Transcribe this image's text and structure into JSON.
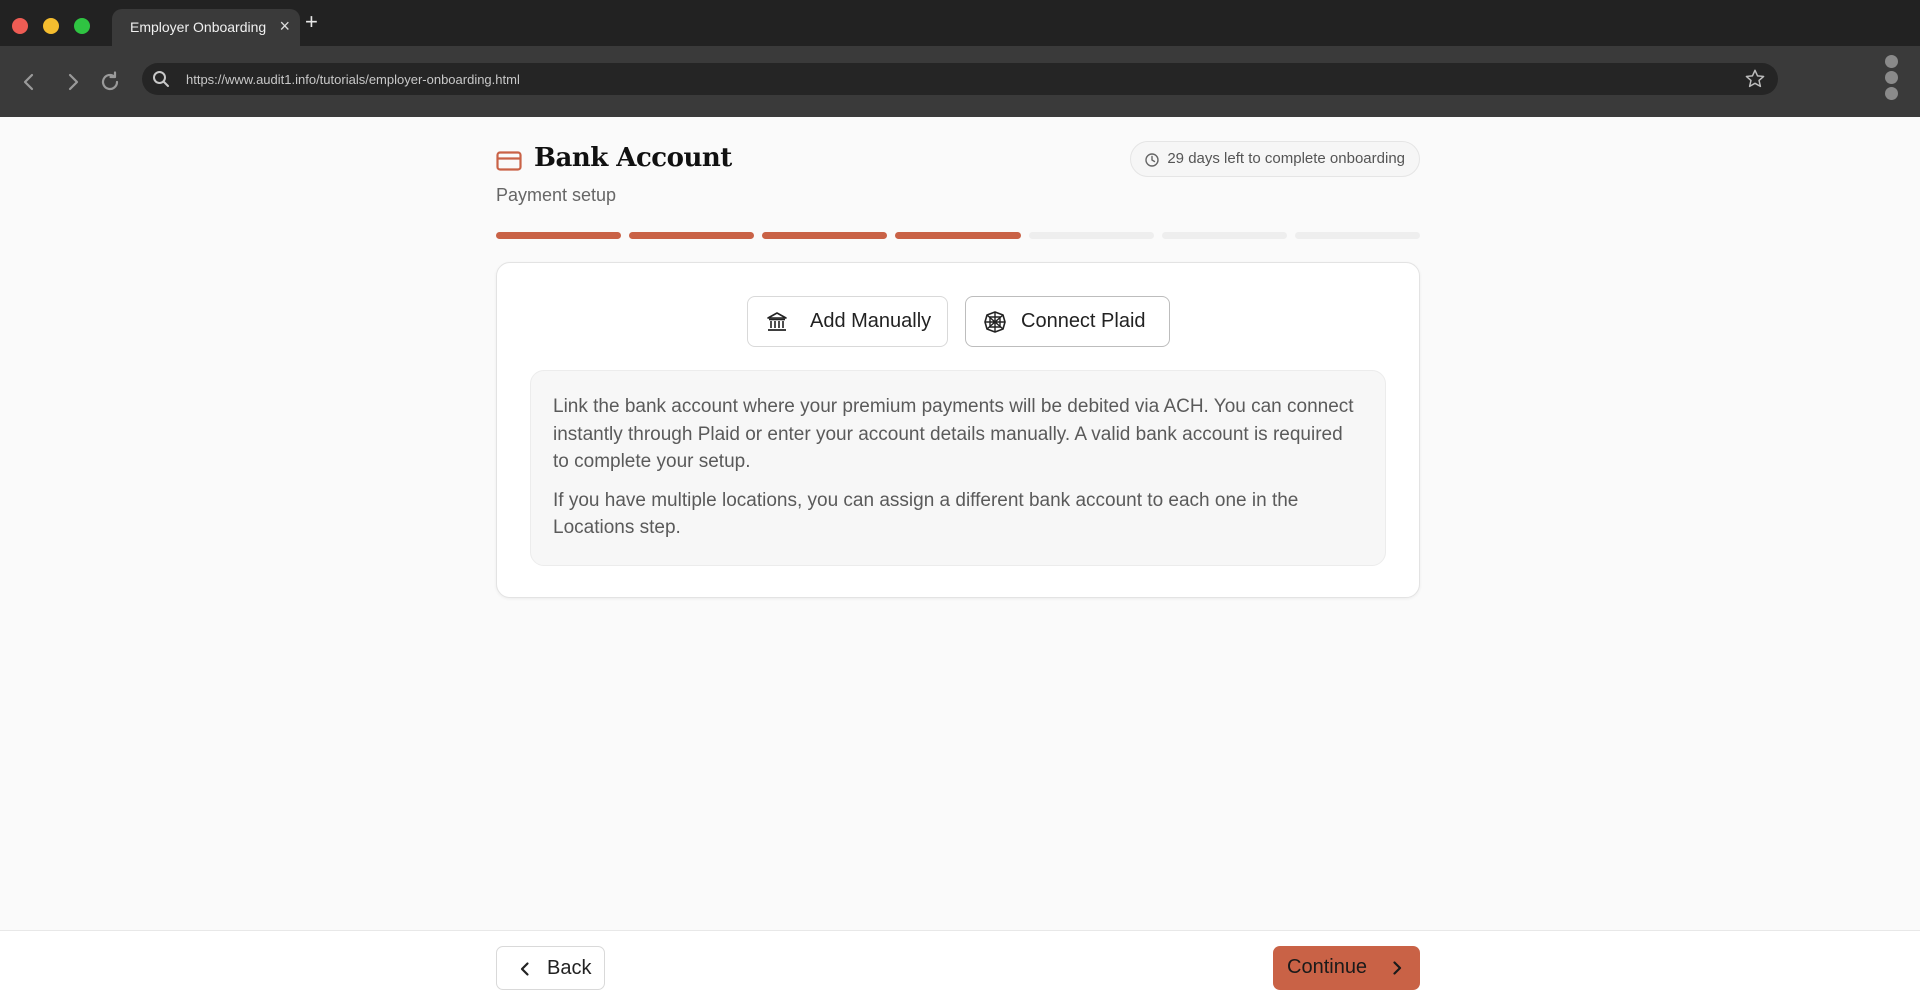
{
  "browser": {
    "tab_title": "Employer Onboarding",
    "tab_close": "×",
    "new_tab": "+",
    "url": "https://www.audit1.info/tutorials/employer-onboarding.html"
  },
  "header": {
    "title": "Bank Account",
    "subtitle": "Payment setup",
    "deadline": "29 days left to complete onboarding"
  },
  "progress": {
    "total_steps": 7,
    "completed_steps": 4,
    "accent_color": "#c96246"
  },
  "options": {
    "manual_label": "Add Manually",
    "plaid_label": "Connect Plaid"
  },
  "info": {
    "paragraph1": "Link the bank account where your premium payments will be debited via ACH. You can connect instantly through Plaid or enter your account details manually. A valid bank account is required to complete your setup.",
    "paragraph2": "If you have multiple locations, you can assign a different bank account to each one in the Locations step."
  },
  "footer": {
    "back_label": "Back",
    "continue_label": "Continue"
  },
  "icons": {
    "title": "credit-card-icon",
    "deadline": "clock-icon",
    "manual": "bank-icon",
    "plaid": "plaid-icon",
    "back": "chevron-left-icon",
    "continue": "chevron-right-icon"
  }
}
